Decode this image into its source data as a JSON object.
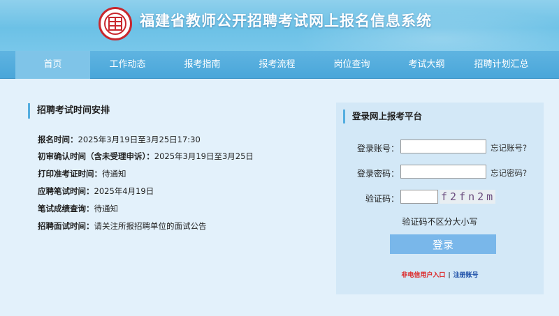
{
  "header": {
    "site_title": "福建省教师公开招聘考试网上报名信息系统"
  },
  "nav": {
    "items": [
      {
        "label": "首页"
      },
      {
        "label": "工作动态"
      },
      {
        "label": "报考指南"
      },
      {
        "label": "报考流程"
      },
      {
        "label": "岗位查询"
      },
      {
        "label": "考试大纲"
      },
      {
        "label": "招聘计划汇总"
      }
    ]
  },
  "schedule": {
    "title": "招聘考试时间安排",
    "rows": [
      {
        "label": "报名时间：",
        "value": "2025年3月19日至3月25日17:30"
      },
      {
        "label": "初审确认时间（含未受理申诉）：",
        "value": "2025年3月19日至3月25日"
      },
      {
        "label": "打印准考证时间：",
        "value": "待通知"
      },
      {
        "label": "应聘笔试时间：",
        "value": "2025年4月19日"
      },
      {
        "label": "笔试成绩查询：",
        "value": "待通知"
      },
      {
        "label": "招聘面试时间：",
        "value": "请关注所报招聘单位的面试公告"
      }
    ]
  },
  "login": {
    "title": "登录网上报考平台",
    "account_label": "登录账号：",
    "account_value": "",
    "forgot_account": "忘记账号?",
    "password_label": "登录密码：",
    "password_value": "",
    "forgot_password": "忘记密码?",
    "captcha_label": "验证码：",
    "captcha_value": "",
    "captcha_image_text": "f2fn2m",
    "hint": "验证码不区分大小写",
    "login_button": "登录",
    "non_telecom_link": "非电信用户入口",
    "separator": "|",
    "register_link": "注册账号"
  },
  "colors": {
    "header_bg": "#78c7ea",
    "nav_bg": "#4aa6d9",
    "nav_active": "#7fc4e8",
    "page_bg": "#e3f1fb",
    "login_box_bg": "#d3e8f7",
    "login_button": "#79b7ea",
    "link_red": "#dd2222",
    "link_blue": "#1c4fa8"
  }
}
